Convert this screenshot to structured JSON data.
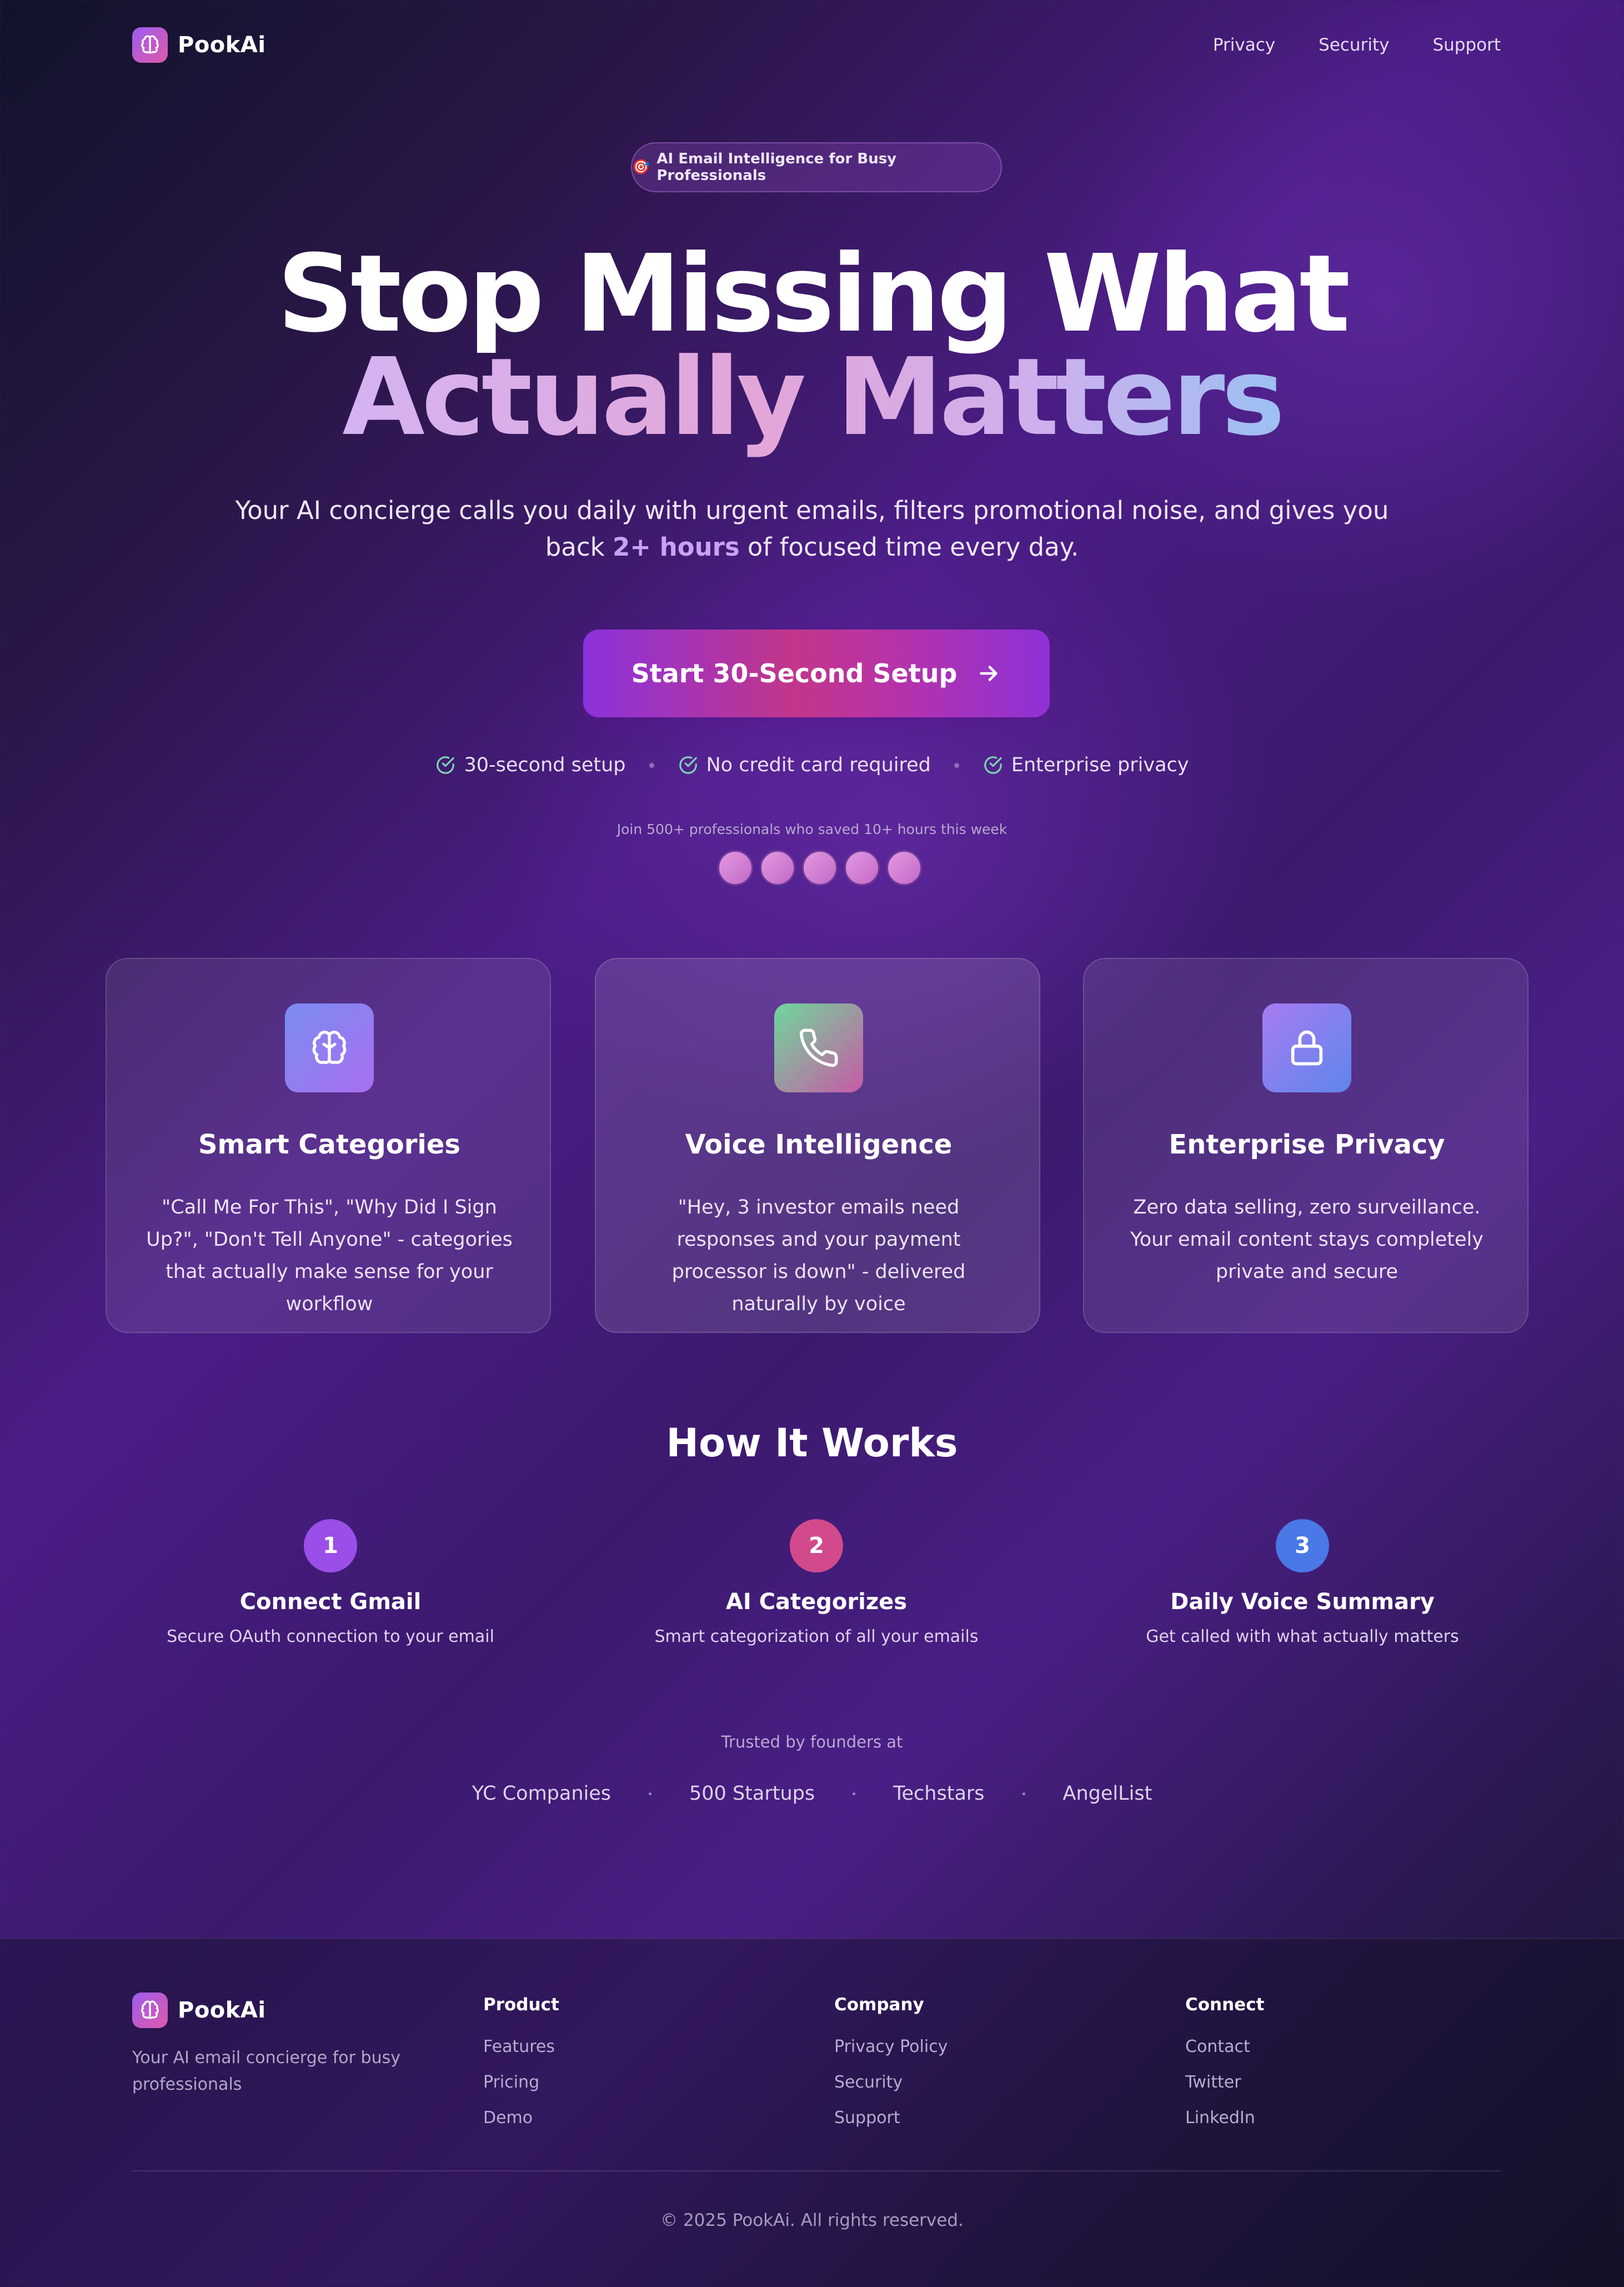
{
  "brand": {
    "name": "PookAi",
    "logo_icon": "brain-icon"
  },
  "nav": {
    "links": [
      "Privacy",
      "Security",
      "Support"
    ]
  },
  "hero": {
    "badge_emoji": "🎯",
    "badge": "AI Email Intelligence for Busy Professionals",
    "title_line1": "Stop Missing What",
    "title_line2": "Actually Matters",
    "subtitle_before": "Your AI concierge calls you daily with urgent emails, filters promotional noise, and gives you back ",
    "subtitle_highlight": "2+ hours",
    "subtitle_after": " of focused time every day.",
    "cta_label": "Start 30-Second Setup",
    "checks": [
      "30-second setup",
      "No credit card required",
      "Enterprise privacy"
    ],
    "social_proof": "Join 500+ professionals who saved 10+ hours this week",
    "avatar_count": 5
  },
  "features": [
    {
      "icon": "brain-icon",
      "title": "Smart Categories",
      "description": "\"Call Me For This\", \"Why Did I Sign Up?\", \"Don't Tell Anyone\" - categories that actually make sense for your workflow"
    },
    {
      "icon": "phone-icon",
      "title": "Voice Intelligence",
      "description": "\"Hey, 3 investor emails need responses and your payment processor is down\" - delivered naturally by voice"
    },
    {
      "icon": "lock-icon",
      "title": "Enterprise Privacy",
      "description": "Zero data selling, zero surveillance. Your email content stays completely private and secure"
    }
  ],
  "how_it_works": {
    "title": "How It Works",
    "steps": [
      {
        "number": "1",
        "title": "Connect Gmail",
        "description": "Secure OAuth connection to your email"
      },
      {
        "number": "2",
        "title": "AI Categorizes",
        "description": "Smart categorization of all your emails"
      },
      {
        "number": "3",
        "title": "Daily Voice Summary",
        "description": "Get called with what actually matters"
      }
    ]
  },
  "trusted": {
    "label": "Trusted by founders at",
    "companies": [
      "YC Companies",
      "500 Startups",
      "Techstars",
      "AngelList"
    ]
  },
  "footer": {
    "brand": "PookAi",
    "tagline": "Your AI email concierge for busy professionals",
    "columns": [
      {
        "heading": "Product",
        "links": [
          "Features",
          "Pricing",
          "Demo"
        ]
      },
      {
        "heading": "Company",
        "links": [
          "Privacy Policy",
          "Security",
          "Support"
        ]
      },
      {
        "heading": "Connect",
        "links": [
          "Contact",
          "Twitter",
          "LinkedIn"
        ]
      }
    ],
    "copyright": "© 2025 PookAi. All rights reserved."
  },
  "colors": {
    "accent_purple": "#9b5cf0",
    "accent_pink": "#e05aa8",
    "step1": "#9a4fe8",
    "step2": "#d24a8c",
    "step3": "#4a78e6",
    "check": "#7fd6b0"
  }
}
